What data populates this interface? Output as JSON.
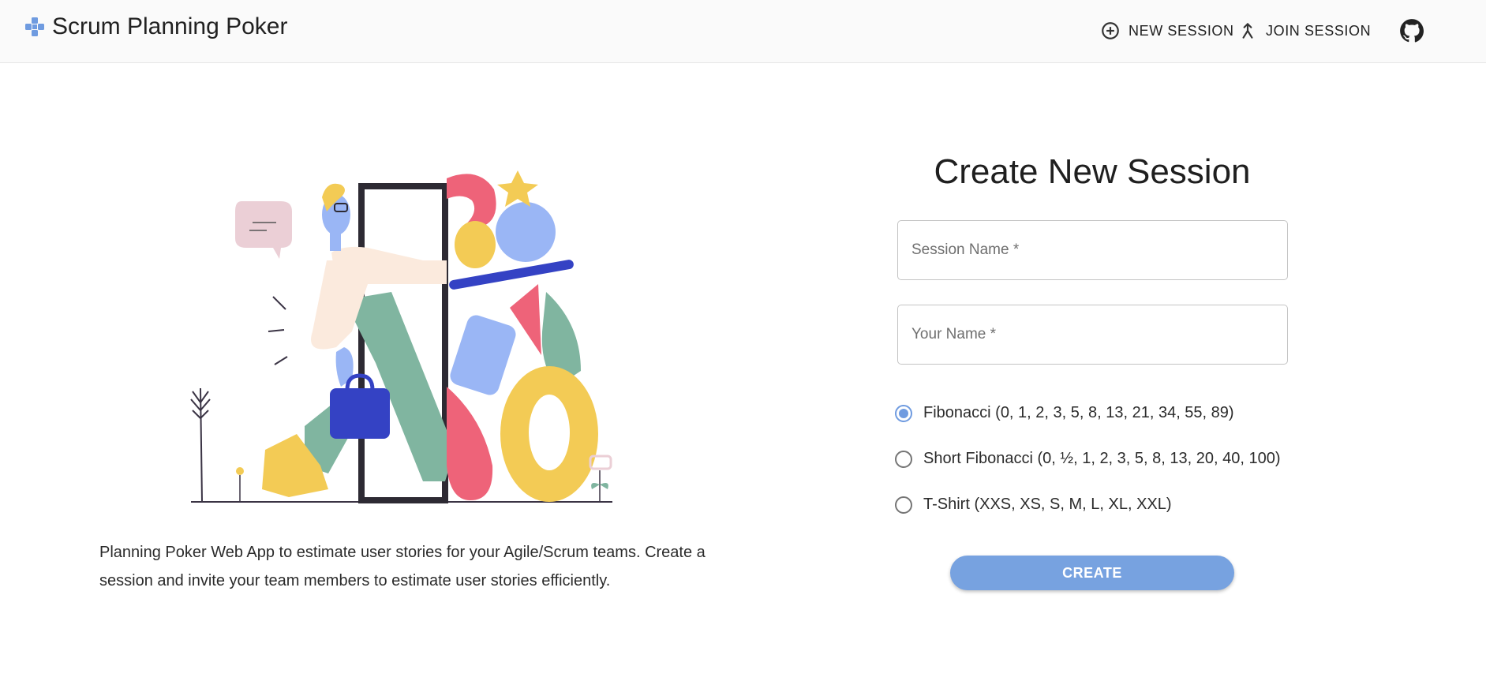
{
  "header": {
    "title": "Scrum Planning Poker",
    "new_session_label": "NEW SESSION",
    "join_session_label": "JOIN SESSION",
    "icons": [
      "logo-icon",
      "plus-circle-icon",
      "merge-icon",
      "github-icon"
    ]
  },
  "intro": {
    "text": "Planning Poker Web App to estimate user stories for your Agile/Scrum teams. Create a session and invite your team members to estimate user stories efficiently."
  },
  "form": {
    "title": "Create New Session",
    "session_name_placeholder": "Session Name *",
    "session_name_value": "",
    "your_name_placeholder": "Your Name *",
    "your_name_value": "",
    "options": [
      {
        "label": "Fibonacci (0, 1, 2, 3, 5, 8, 13, 21, 34, 55, 89)",
        "selected": true
      },
      {
        "label": "Short Fibonacci (0, ½, 1, 2, 3, 5, 8, 13, 20, 40, 100)",
        "selected": false
      },
      {
        "label": "T-Shirt (XXS, XS, S, M, L, XL, XXL)",
        "selected": false
      }
    ],
    "create_label": "CREATE"
  },
  "colors": {
    "accent": "#6f9be0",
    "button": "#77a2e0",
    "appbar": "#fafafa"
  }
}
